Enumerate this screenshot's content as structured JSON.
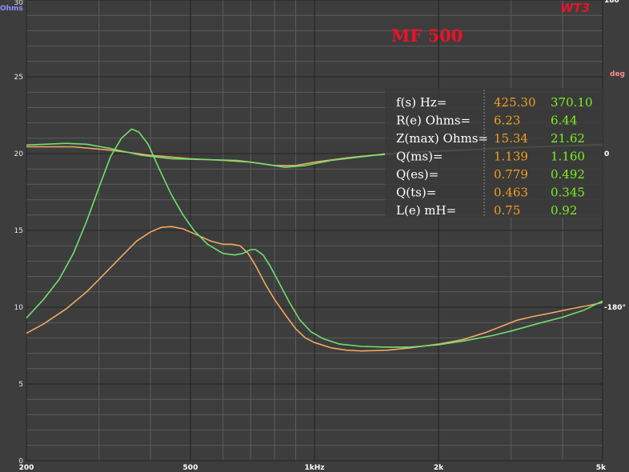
{
  "brand": "WT3",
  "left_unit": "Ohms",
  "right_unit": "deg",
  "chart_data": {
    "type": "line",
    "title": "MF 500",
    "x_scale": "log",
    "xlim": [
      200,
      5000
    ],
    "ylim": [
      0,
      30
    ],
    "y2lim": [
      -360,
      180
    ],
    "x_ticks": [
      {
        "value": 200,
        "label": "200"
      },
      {
        "value": 500,
        "label": "500"
      },
      {
        "value": 1000,
        "label": "1kHz"
      },
      {
        "value": 2000,
        "label": "2k"
      },
      {
        "value": 5000,
        "label": "5k"
      }
    ],
    "y_ticks": [
      {
        "value": 0,
        "label": "0"
      },
      {
        "value": 5,
        "label": "5"
      },
      {
        "value": 10,
        "label": "10"
      },
      {
        "value": 15,
        "label": "15"
      },
      {
        "value": 20,
        "label": "20"
      },
      {
        "value": 25,
        "label": "25"
      },
      {
        "value": 30,
        "label": "30"
      }
    ],
    "y2_ticks": [
      {
        "value": 180,
        "label": "180"
      },
      {
        "value": 0,
        "label": "0"
      },
      {
        "value": -180,
        "label": "-180°"
      }
    ],
    "grid": true,
    "series": [
      {
        "color": "#f0a860",
        "impedance": [
          [
            200,
            8.3
          ],
          [
            220,
            8.9
          ],
          [
            250,
            9.9
          ],
          [
            280,
            11.0
          ],
          [
            310,
            12.2
          ],
          [
            340,
            13.3
          ],
          [
            370,
            14.3
          ],
          [
            400,
            14.9
          ],
          [
            425,
            15.2
          ],
          [
            450,
            15.25
          ],
          [
            480,
            15.1
          ],
          [
            520,
            14.7
          ],
          [
            560,
            14.3
          ],
          [
            600,
            14.1
          ],
          [
            630,
            14.1
          ],
          [
            660,
            14.0
          ],
          [
            690,
            13.5
          ],
          [
            720,
            12.7
          ],
          [
            760,
            11.5
          ],
          [
            800,
            10.5
          ],
          [
            850,
            9.5
          ],
          [
            900,
            8.6
          ],
          [
            950,
            8.0
          ],
          [
            1000,
            7.7
          ],
          [
            1100,
            7.35
          ],
          [
            1200,
            7.2
          ],
          [
            1300,
            7.15
          ],
          [
            1500,
            7.2
          ],
          [
            1700,
            7.35
          ],
          [
            2000,
            7.6
          ],
          [
            2300,
            7.9
          ],
          [
            2600,
            8.35
          ],
          [
            2900,
            8.85
          ],
          [
            3100,
            9.15
          ],
          [
            3400,
            9.4
          ],
          [
            3800,
            9.65
          ],
          [
            4200,
            9.9
          ],
          [
            4600,
            10.1
          ],
          [
            5000,
            10.3
          ]
        ],
        "phase": [
          [
            200,
            8
          ],
          [
            260,
            8
          ],
          [
            320,
            4
          ],
          [
            400,
            -2
          ],
          [
            500,
            -6
          ],
          [
            600,
            -8
          ],
          [
            700,
            -10
          ],
          [
            800,
            -14
          ],
          [
            900,
            -14
          ],
          [
            1000,
            -10
          ],
          [
            1200,
            -5
          ],
          [
            1500,
            0
          ],
          [
            2000,
            3
          ],
          [
            2500,
            5
          ],
          [
            3000,
            7
          ],
          [
            4000,
            9
          ],
          [
            5000,
            10
          ]
        ]
      },
      {
        "color": "#6ee06e",
        "impedance": [
          [
            200,
            9.3
          ],
          [
            220,
            10.5
          ],
          [
            240,
            11.8
          ],
          [
            260,
            13.5
          ],
          [
            280,
            15.6
          ],
          [
            300,
            17.8
          ],
          [
            320,
            19.8
          ],
          [
            340,
            21.0
          ],
          [
            360,
            21.6
          ],
          [
            375,
            21.4
          ],
          [
            395,
            20.6
          ],
          [
            420,
            19.0
          ],
          [
            450,
            17.3
          ],
          [
            480,
            16.0
          ],
          [
            510,
            15.0
          ],
          [
            550,
            14.1
          ],
          [
            600,
            13.5
          ],
          [
            640,
            13.4
          ],
          [
            670,
            13.5
          ],
          [
            700,
            13.75
          ],
          [
            720,
            13.75
          ],
          [
            750,
            13.4
          ],
          [
            780,
            12.7
          ],
          [
            820,
            11.6
          ],
          [
            870,
            10.3
          ],
          [
            920,
            9.2
          ],
          [
            980,
            8.4
          ],
          [
            1050,
            7.95
          ],
          [
            1150,
            7.6
          ],
          [
            1300,
            7.45
          ],
          [
            1500,
            7.4
          ],
          [
            1700,
            7.4
          ],
          [
            2000,
            7.55
          ],
          [
            2300,
            7.8
          ],
          [
            2700,
            8.15
          ],
          [
            3000,
            8.45
          ],
          [
            3500,
            8.95
          ],
          [
            4000,
            9.35
          ],
          [
            4500,
            9.8
          ],
          [
            5000,
            10.4
          ]
        ],
        "phase": [
          [
            200,
            10
          ],
          [
            250,
            12
          ],
          [
            280,
            11
          ],
          [
            320,
            6
          ],
          [
            380,
            -2
          ],
          [
            450,
            -6
          ],
          [
            550,
            -7
          ],
          [
            650,
            -8
          ],
          [
            750,
            -12
          ],
          [
            850,
            -16
          ],
          [
            950,
            -14
          ],
          [
            1100,
            -8
          ],
          [
            1400,
            -2
          ],
          [
            1800,
            2
          ],
          [
            2500,
            5
          ],
          [
            3500,
            8
          ],
          [
            5000,
            11
          ]
        ]
      }
    ]
  },
  "params_table": {
    "rows": [
      {
        "label": "f(s) Hz=",
        "a": "425.30",
        "b": "370.10"
      },
      {
        "label": "R(e) Ohms=",
        "a": "6.23",
        "b": "6.44"
      },
      {
        "label": "Z(max) Ohms=",
        "a": "15.34",
        "b": "21.62"
      },
      {
        "label": "Q(ms)=",
        "a": "1.139",
        "b": "1.160"
      },
      {
        "label": "Q(es)=",
        "a": "0.779",
        "b": "0.492"
      },
      {
        "label": "Q(ts)=",
        "a": "0.463",
        "b": "0.345"
      },
      {
        "label": "L(e) mH=",
        "a": "0.75",
        "b": "0.92"
      }
    ],
    "color_a": "#f0a020",
    "color_b": "#7cf020"
  }
}
